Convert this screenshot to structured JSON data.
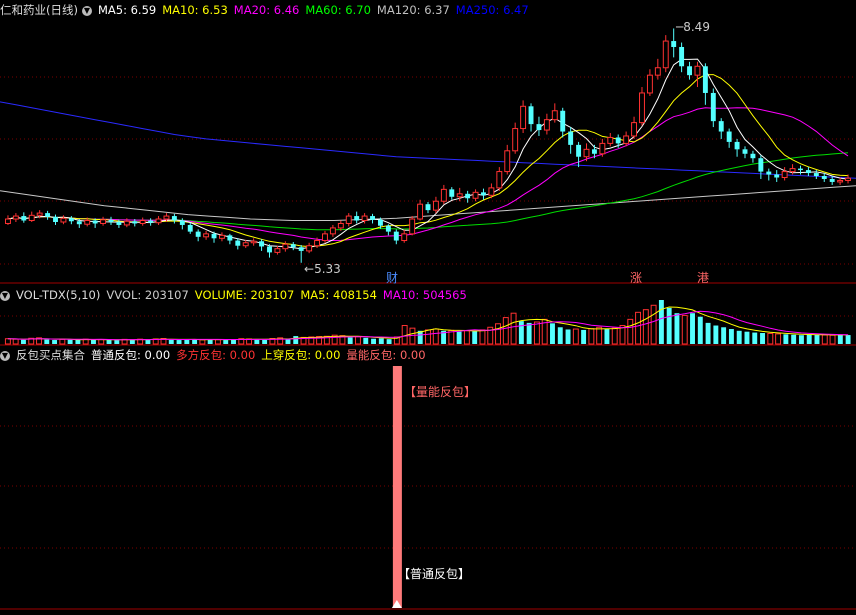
{
  "chart_data": {
    "type": "candlestick",
    "main": {
      "title": "仁和药业(日线)",
      "indicators": [
        {
          "name": "MA5",
          "value": "6.59",
          "color": "#ffffff"
        },
        {
          "name": "MA10",
          "value": "6.53",
          "color": "#ffff00"
        },
        {
          "name": "MA20",
          "value": "6.46",
          "color": "#ff00ff"
        },
        {
          "name": "MA60",
          "value": "6.70",
          "color": "#00ff00"
        },
        {
          "name": "MA120",
          "value": "6.37",
          "color": "#c0c0c0"
        },
        {
          "name": "MA250",
          "value": "6.47",
          "color": "#0000ff"
        }
      ],
      "high_label": "8.49",
      "low_label": "5.33",
      "markers": [
        "财",
        "涨",
        "港"
      ],
      "candles": [
        [
          5.86,
          5.92,
          5.97,
          5.84
        ],
        [
          5.92,
          5.96,
          6.0,
          5.88
        ],
        [
          5.96,
          5.9,
          6.01,
          5.87
        ],
        [
          5.9,
          5.97,
          6.02,
          5.88
        ],
        [
          5.97,
          6.0,
          6.04,
          5.93
        ],
        [
          6.0,
          5.95,
          6.03,
          5.91
        ],
        [
          5.95,
          5.88,
          5.98,
          5.84
        ],
        [
          5.88,
          5.93,
          5.97,
          5.85
        ],
        [
          5.93,
          5.89,
          5.96,
          5.85
        ],
        [
          5.89,
          5.85,
          5.92,
          5.8
        ],
        [
          5.85,
          5.9,
          5.94,
          5.82
        ],
        [
          5.9,
          5.86,
          5.93,
          5.8
        ],
        [
          5.86,
          5.91,
          5.95,
          5.83
        ],
        [
          5.91,
          5.88,
          5.95,
          5.84
        ],
        [
          5.88,
          5.84,
          5.91,
          5.8
        ],
        [
          5.84,
          5.89,
          5.93,
          5.81
        ],
        [
          5.89,
          5.86,
          5.92,
          5.82
        ],
        [
          5.86,
          5.9,
          5.94,
          5.83
        ],
        [
          5.9,
          5.87,
          5.93,
          5.83
        ],
        [
          5.87,
          5.92,
          5.96,
          5.84
        ],
        [
          5.92,
          5.96,
          6.0,
          5.88
        ],
        [
          5.96,
          5.9,
          5.99,
          5.86
        ],
        [
          5.9,
          5.84,
          5.93,
          5.78
        ],
        [
          5.84,
          5.75,
          5.87,
          5.72
        ],
        [
          5.75,
          5.68,
          5.78,
          5.62
        ],
        [
          5.68,
          5.72,
          5.76,
          5.64
        ],
        [
          5.72,
          5.66,
          5.75,
          5.6
        ],
        [
          5.66,
          5.7,
          5.74,
          5.62
        ],
        [
          5.7,
          5.63,
          5.72,
          5.58
        ],
        [
          5.63,
          5.56,
          5.66,
          5.51
        ],
        [
          5.56,
          5.6,
          5.64,
          5.53
        ],
        [
          5.6,
          5.62,
          5.66,
          5.56
        ],
        [
          5.62,
          5.55,
          5.65,
          5.49
        ],
        [
          5.55,
          5.47,
          5.58,
          5.4
        ],
        [
          5.47,
          5.52,
          5.56,
          5.44
        ],
        [
          5.52,
          5.58,
          5.62,
          5.48
        ],
        [
          5.58,
          5.54,
          5.61,
          5.5
        ],
        [
          5.54,
          5.49,
          5.57,
          5.33
        ],
        [
          5.49,
          5.56,
          5.6,
          5.46
        ],
        [
          5.56,
          5.63,
          5.67,
          5.53
        ],
        [
          5.63,
          5.72,
          5.76,
          5.6
        ],
        [
          5.72,
          5.8,
          5.84,
          5.68
        ],
        [
          5.8,
          5.86,
          5.9,
          5.76
        ],
        [
          5.86,
          5.96,
          6.0,
          5.82
        ],
        [
          5.96,
          5.9,
          6.02,
          5.86
        ],
        [
          5.9,
          5.96,
          6.0,
          5.86
        ],
        [
          5.96,
          5.91,
          5.99,
          5.86
        ],
        [
          5.91,
          5.83,
          5.94,
          5.79
        ],
        [
          5.83,
          5.75,
          5.85,
          5.7
        ],
        [
          5.75,
          5.63,
          5.78,
          5.58
        ],
        [
          5.63,
          5.72,
          5.78,
          5.6
        ],
        [
          5.72,
          5.92,
          5.96,
          5.7
        ],
        [
          5.92,
          6.12,
          6.18,
          5.9
        ],
        [
          6.12,
          6.04,
          6.15,
          6.0
        ],
        [
          6.04,
          6.16,
          6.22,
          6.0
        ],
        [
          6.16,
          6.32,
          6.38,
          6.12
        ],
        [
          6.32,
          6.22,
          6.35,
          6.18
        ],
        [
          6.22,
          6.26,
          6.34,
          6.16
        ],
        [
          6.26,
          6.2,
          6.3,
          6.14
        ],
        [
          6.2,
          6.28,
          6.32,
          6.16
        ],
        [
          6.28,
          6.24,
          6.33,
          6.18
        ],
        [
          6.24,
          6.34,
          6.4,
          6.2
        ],
        [
          6.34,
          6.56,
          6.62,
          6.3
        ],
        [
          6.56,
          6.84,
          6.92,
          6.52
        ],
        [
          6.84,
          7.14,
          7.22,
          6.8
        ],
        [
          7.14,
          7.44,
          7.52,
          7.08
        ],
        [
          7.44,
          7.2,
          7.48,
          7.1
        ],
        [
          7.2,
          7.12,
          7.3,
          7.04
        ],
        [
          7.12,
          7.26,
          7.34,
          7.06
        ],
        [
          7.26,
          7.38,
          7.48,
          7.22
        ],
        [
          7.38,
          7.1,
          7.42,
          7.02
        ],
        [
          7.1,
          6.92,
          7.16,
          6.8
        ],
        [
          6.92,
          6.76,
          6.96,
          6.62
        ],
        [
          6.76,
          6.86,
          6.94,
          6.7
        ],
        [
          6.86,
          6.8,
          6.92,
          6.74
        ],
        [
          6.8,
          6.94,
          7.0,
          6.76
        ],
        [
          6.94,
          7.02,
          7.08,
          6.9
        ],
        [
          7.02,
          6.94,
          7.06,
          6.88
        ],
        [
          6.94,
          7.04,
          7.1,
          6.9
        ],
        [
          7.04,
          7.22,
          7.3,
          7.0
        ],
        [
          7.22,
          7.62,
          7.7,
          7.18
        ],
        [
          7.62,
          7.86,
          7.94,
          7.58
        ],
        [
          7.86,
          7.96,
          8.08,
          7.8
        ],
        [
          7.96,
          8.32,
          8.4,
          7.9
        ],
        [
          8.32,
          8.24,
          8.49,
          8.1
        ],
        [
          8.24,
          7.98,
          8.3,
          7.9
        ],
        [
          7.98,
          7.86,
          8.04,
          7.8
        ],
        [
          7.86,
          7.98,
          8.04,
          7.7
        ],
        [
          7.98,
          7.62,
          8.02,
          7.46
        ],
        [
          7.62,
          7.24,
          7.68,
          7.16
        ],
        [
          7.24,
          7.1,
          7.28,
          7.0
        ],
        [
          7.1,
          6.96,
          7.14,
          6.88
        ],
        [
          6.96,
          6.86,
          7.0,
          6.76
        ],
        [
          6.86,
          6.8,
          6.9,
          6.74
        ],
        [
          6.8,
          6.74,
          6.84,
          6.68
        ],
        [
          6.74,
          6.56,
          6.78,
          6.46
        ],
        [
          6.56,
          6.52,
          6.6,
          6.44
        ],
        [
          6.52,
          6.48,
          6.58,
          6.42
        ],
        [
          6.48,
          6.56,
          6.62,
          6.44
        ],
        [
          6.56,
          6.6,
          6.66,
          6.52
        ],
        [
          6.6,
          6.58,
          6.64,
          6.52
        ],
        [
          6.58,
          6.54,
          6.62,
          6.5
        ],
        [
          6.54,
          6.5,
          6.58,
          6.46
        ],
        [
          6.5,
          6.46,
          6.54,
          6.42
        ],
        [
          6.46,
          6.42,
          6.5,
          6.38
        ],
        [
          6.42,
          6.44,
          6.48,
          6.38
        ],
        [
          6.44,
          6.47,
          6.52,
          6.4
        ]
      ],
      "ma250": [
        7.5,
        7.46,
        7.42,
        7.38,
        7.34,
        7.3,
        7.26,
        7.22,
        7.18,
        7.14,
        7.1,
        7.06,
        7.03,
        7.0,
        6.98,
        6.96,
        6.94,
        6.92,
        6.9,
        6.88,
        6.86,
        6.84,
        6.82,
        6.8,
        6.78,
        6.76,
        6.75,
        6.74,
        6.73,
        6.72,
        6.71,
        6.7,
        6.69,
        6.68,
        6.67,
        6.66,
        6.65,
        6.64,
        6.63,
        6.62,
        6.61,
        6.6,
        6.59,
        6.58,
        6.57,
        6.56,
        6.55,
        6.54,
        6.53,
        6.52,
        6.51,
        6.5,
        6.49,
        6.48,
        6.47
      ],
      "ma120": [
        6.3,
        6.26,
        6.22,
        6.18,
        6.14,
        6.1,
        6.07,
        6.04,
        6.01,
        5.98,
        5.96,
        5.94,
        5.92,
        5.91,
        5.9,
        5.9,
        5.9,
        5.91,
        5.92,
        5.93,
        5.95,
        5.97,
        5.99,
        6.01,
        6.03,
        6.05,
        6.07,
        6.09,
        6.11,
        6.13,
        6.15,
        6.17,
        6.19,
        6.21,
        6.23,
        6.25,
        6.27,
        6.29,
        6.31,
        6.33,
        6.35,
        6.37
      ]
    },
    "volume": {
      "title": "VOL-TDX(5,10)",
      "indicators": [
        {
          "name": "VVOL",
          "value": "203107",
          "color": "#cccccc"
        },
        {
          "name": "VOLUME",
          "value": "203107",
          "color": "#ffff00"
        },
        {
          "name": "MA5",
          "value": "408154",
          "color": "#ffff00"
        },
        {
          "name": "MA10",
          "value": "504565",
          "color": "#ff00ff"
        }
      ],
      "values": [
        120,
        110,
        95,
        130,
        140,
        100,
        90,
        105,
        98,
        92,
        110,
        95,
        100,
        96,
        90,
        105,
        98,
        110,
        102,
        115,
        125,
        96,
        90,
        100,
        110,
        95,
        105,
        98,
        90,
        110,
        120,
        115,
        100,
        95,
        125,
        140,
        110,
        180,
        150,
        160,
        170,
        175,
        200,
        190,
        150,
        165,
        140,
        120,
        130,
        110,
        160,
        420,
        360,
        300,
        320,
        340,
        300,
        310,
        280,
        300,
        290,
        320,
        380,
        460,
        600,
        700,
        520,
        480,
        500,
        560,
        470,
        380,
        330,
        340,
        320,
        350,
        380,
        340,
        360,
        420,
        560,
        720,
        780,
        880,
        1000,
        820,
        700,
        650,
        700,
        620,
        480,
        420,
        380,
        340,
        300,
        280,
        260,
        250,
        240,
        230,
        220,
        210,
        200,
        220,
        210,
        205,
        200,
        210,
        203
      ],
      "up": [
        1,
        1,
        0,
        1,
        1,
        0,
        0,
        1,
        0,
        0,
        1,
        0,
        1,
        0,
        0,
        1,
        0,
        1,
        0,
        1,
        1,
        0,
        0,
        0,
        0,
        1,
        0,
        1,
        0,
        0,
        1,
        1,
        0,
        0,
        1,
        1,
        0,
        0,
        1,
        1,
        1,
        1,
        1,
        1,
        0,
        1,
        0,
        0,
        0,
        0,
        1,
        1,
        1,
        0,
        1,
        1,
        0,
        1,
        0,
        1,
        0,
        1,
        1,
        1,
        1,
        1,
        0,
        0,
        1,
        1,
        0,
        0,
        0,
        1,
        0,
        1,
        1,
        0,
        1,
        1,
        1,
        1,
        1,
        1,
        0,
        0,
        0,
        1,
        0,
        0,
        0,
        0,
        0,
        0,
        0,
        0,
        0,
        0,
        1,
        1,
        0,
        0,
        0,
        0,
        0,
        1,
        1
      ]
    },
    "signal": {
      "title": "反包买点集合",
      "indicators": [
        {
          "name": "普通反包",
          "value": "0.00",
          "color": "#ffffff"
        },
        {
          "name": "多方反包",
          "value": "0.00",
          "color": "#ff3333"
        },
        {
          "name": "上穿反包",
          "value": "0.00",
          "color": "#ffff00"
        },
        {
          "name": "量能反包",
          "value": "0.00",
          "color": "#ff6666"
        }
      ],
      "tag_top": "【量能反包】",
      "tag_bottom": "【普通反包】",
      "bar_index": 50
    },
    "colors": {
      "up": "#ff3232",
      "down": "#54ffff",
      "grid": "#7a0000",
      "axis": "#a00000"
    }
  }
}
